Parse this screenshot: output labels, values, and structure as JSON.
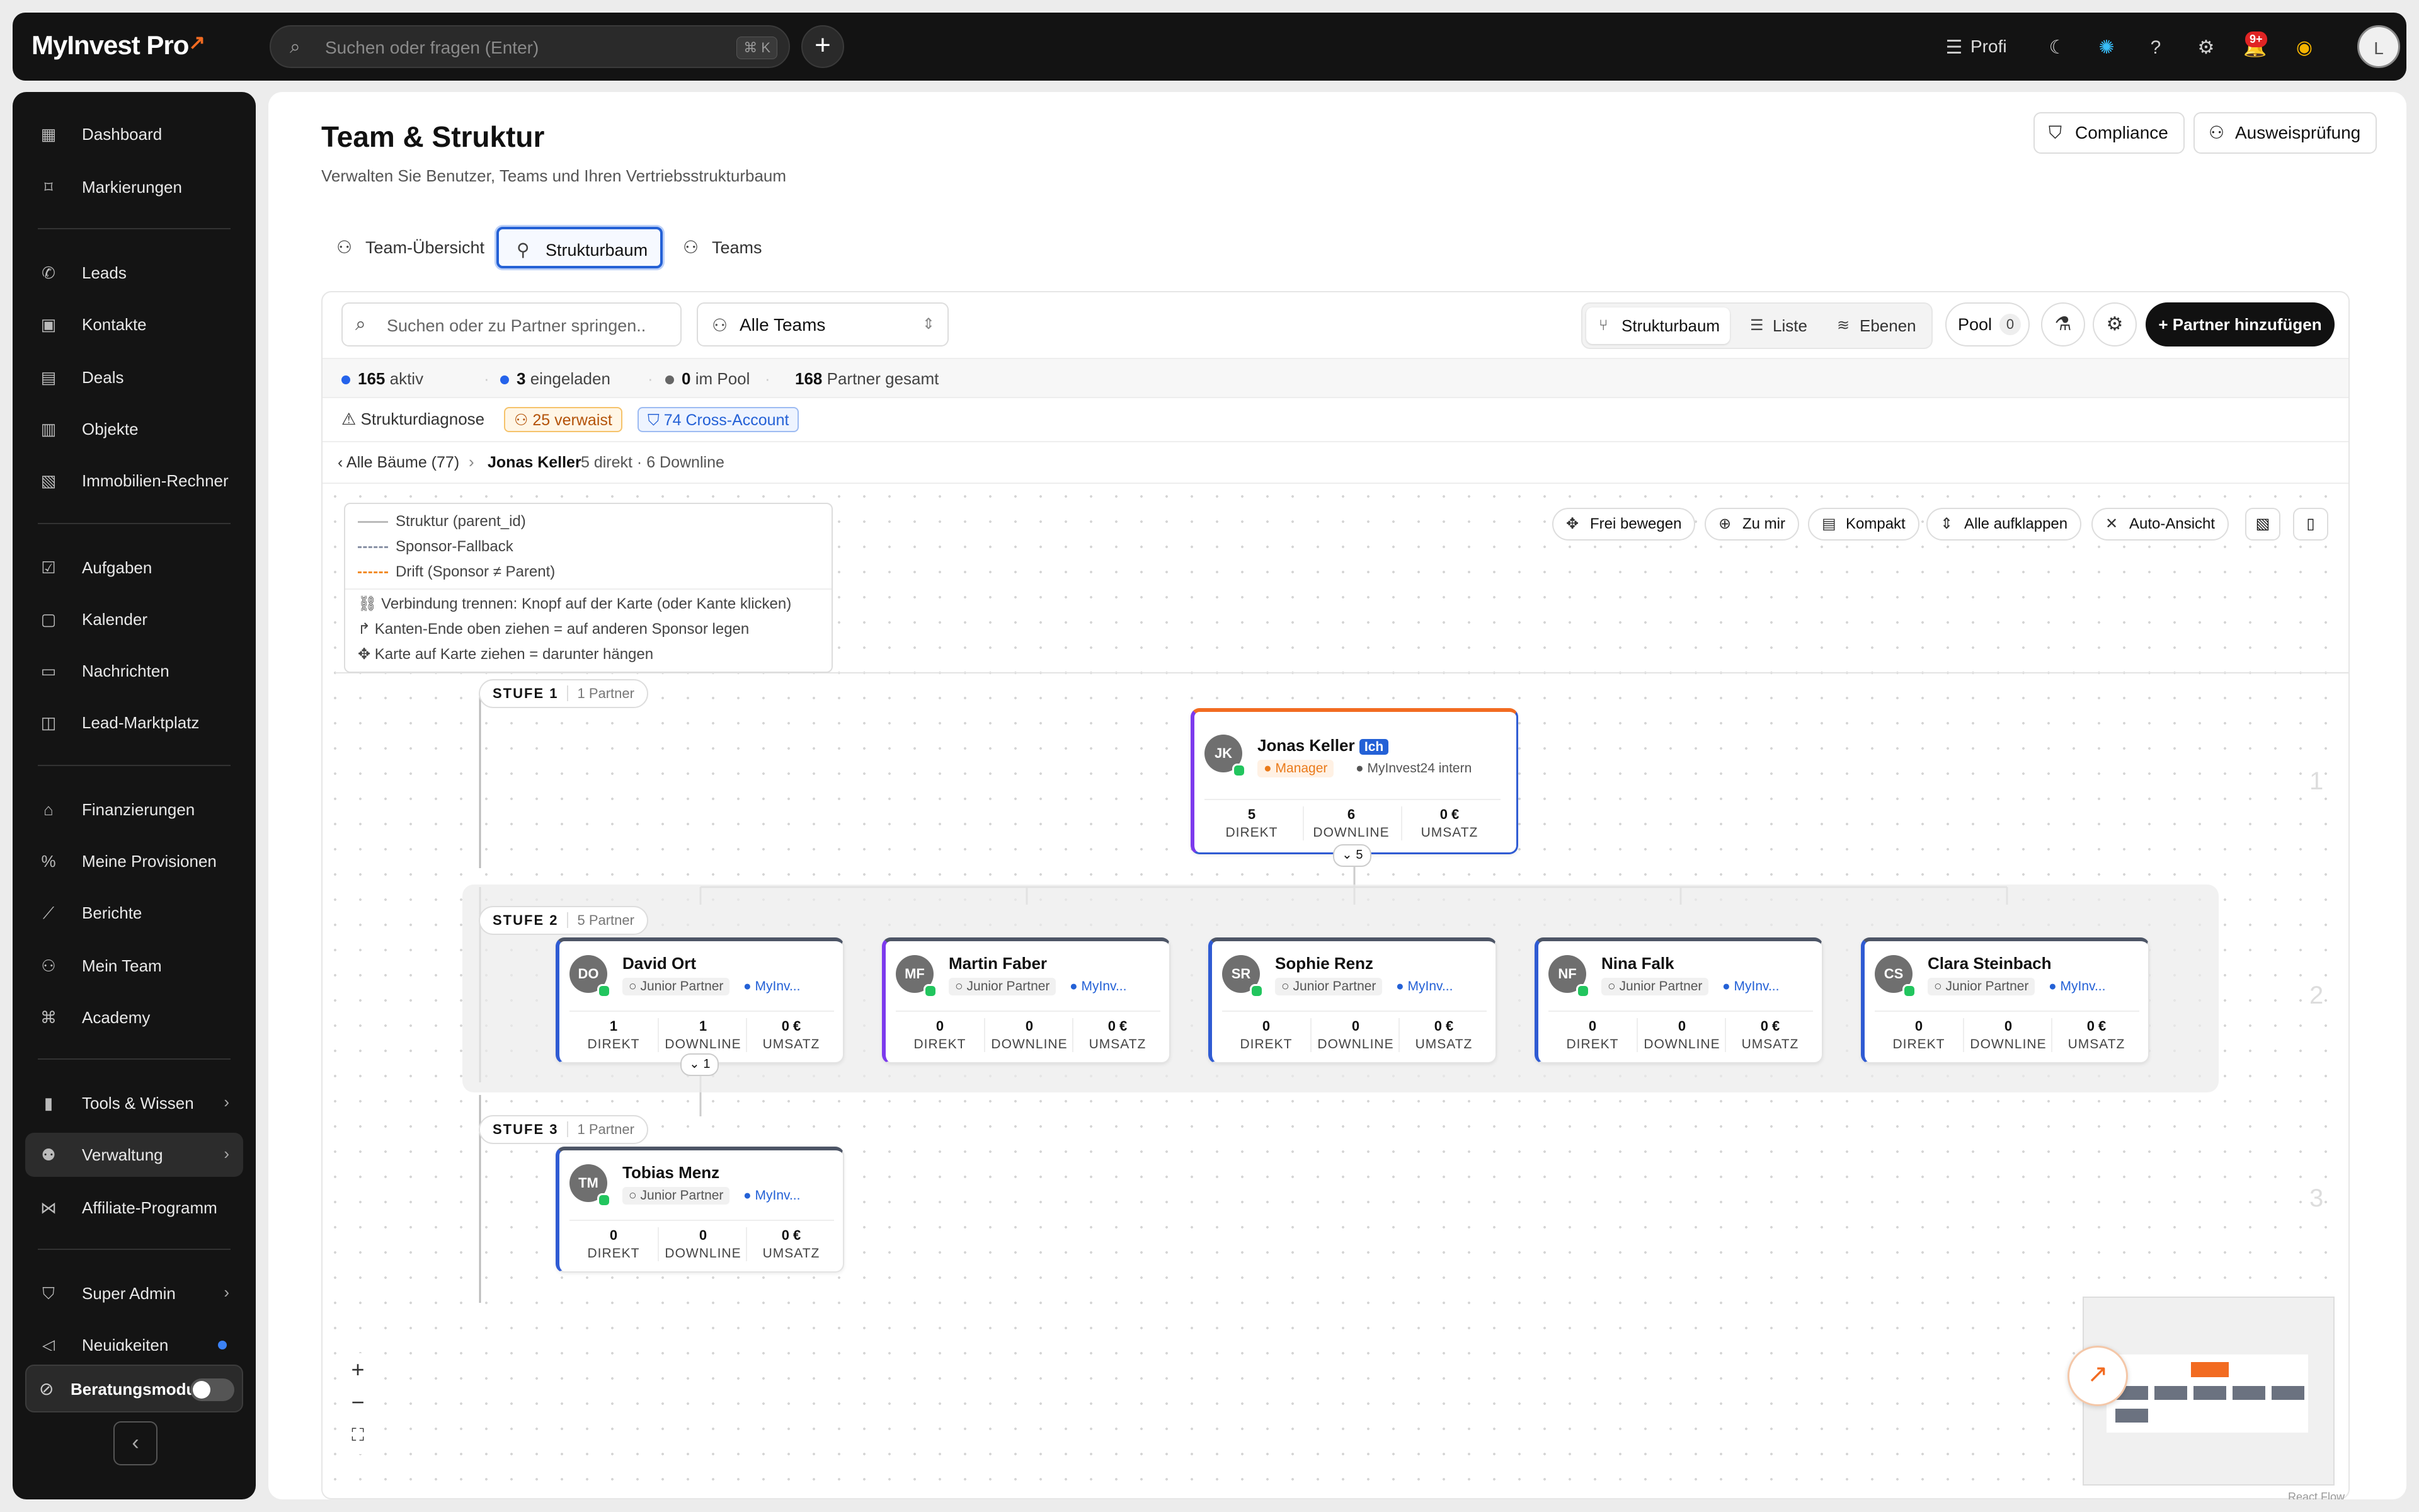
{
  "app": {
    "logo": "MyInvest Pro",
    "logo_mark": "↗"
  },
  "topbar": {
    "search_placeholder": "Suchen oder fragen (Enter)",
    "search_shortcut": "⌘ K",
    "profi_label": "Profi",
    "notif_badge": "9+",
    "avatar_initial": "L"
  },
  "sidebar": {
    "items": [
      {
        "label": "Dashboard",
        "icon": "grid-icon"
      },
      {
        "label": "Markierungen",
        "icon": "bookmark-icon"
      },
      {
        "label": "Leads",
        "icon": "phone-icon"
      },
      {
        "label": "Kontakte",
        "icon": "contact-icon"
      },
      {
        "label": "Deals",
        "icon": "briefcase-icon"
      },
      {
        "label": "Objekte",
        "icon": "building-icon"
      },
      {
        "label": "Immobilien-Rechner",
        "icon": "calculator-icon"
      },
      {
        "label": "Aufgaben",
        "icon": "checkbox-icon"
      },
      {
        "label": "Kalender",
        "icon": "calendar-icon"
      },
      {
        "label": "Nachrichten",
        "icon": "message-icon"
      },
      {
        "label": "Lead-Marktplatz",
        "icon": "shopping-bag-icon"
      },
      {
        "label": "Finanzierungen",
        "icon": "bank-icon"
      },
      {
        "label": "Meine Provisionen",
        "icon": "percent-icon"
      },
      {
        "label": "Berichte",
        "icon": "chart-icon"
      },
      {
        "label": "Mein Team",
        "icon": "users-icon"
      },
      {
        "label": "Academy",
        "icon": "graduation-icon"
      },
      {
        "label": "Tools & Wissen",
        "icon": "bar-chart-icon"
      },
      {
        "label": "Verwaltung",
        "icon": "user-cog-icon"
      },
      {
        "label": "Affiliate-Programm",
        "icon": "share-icon"
      },
      {
        "label": "Super Admin",
        "icon": "shield-icon"
      },
      {
        "label": "Neuigkeiten",
        "icon": "megaphone-icon"
      }
    ],
    "beratung_label": "Beratungsmodus"
  },
  "page": {
    "title": "Team & Struktur",
    "subtitle": "Verwalten Sie Benutzer, Teams und Ihren Vertriebsstrukturbaum",
    "compliance_label": "Compliance",
    "ausweis_label": "Ausweisprüfung",
    "tabs": [
      "Team-Übersicht",
      "Strukturbaum",
      "Teams"
    ]
  },
  "toolbar": {
    "search_placeholder": "Suchen oder zu Partner springen..",
    "team_select": "Alle Teams",
    "views": [
      "Strukturbaum",
      "Liste",
      "Ebenen"
    ],
    "pool_label": "Pool",
    "pool_count": "0",
    "add_partner": "+ Partner hinzufügen"
  },
  "stats": {
    "aktiv_num": "165",
    "aktiv_label": "aktiv",
    "eingeladen_num": "3",
    "eingeladen_label": "eingeladen",
    "pool_num": "0",
    "pool_label": "im Pool",
    "gesamt_num": "168",
    "gesamt_label": "Partner gesamt",
    "colors": {
      "aktiv": "#2563eb",
      "eingeladen": "#2563eb",
      "pool": "#666666"
    }
  },
  "diagnose": {
    "label": "Strukturdiagnose",
    "verwaist": "25 verwaist",
    "cross": "74 Cross-Account"
  },
  "breadcrumb": {
    "back": "‹ Alle Bäume (77)",
    "sep": "›",
    "current": "Jonas Keller",
    "detail": "5 direkt · 6 Downline"
  },
  "legend": {
    "items": [
      "Struktur (parent_id)",
      "Sponsor-Fallback",
      "Drift (Sponsor ≠ Parent)",
      "Verbindung trennen: Knopf auf der Karte (oder Kante klicken)",
      "Kanten-Ende oben ziehen = auf anderen Sponsor legen",
      "Karte auf Karte ziehen = darunter hängen"
    ]
  },
  "canvas_tools": [
    "Frei bewegen",
    "Zu mir",
    "Kompakt",
    "Alle aufklappen",
    "Auto-Ansicht"
  ],
  "levels": [
    {
      "label": "STUFE 1",
      "count": "1 Partner",
      "num": "1"
    },
    {
      "label": "STUFE 2",
      "count": "5 Partner",
      "num": "2"
    },
    {
      "label": "STUFE 3",
      "count": "1 Partner",
      "num": "3"
    }
  ],
  "metric_keys": {
    "direkt": "DIREKT",
    "downline": "DOWNLINE",
    "umsatz": "UMSATZ"
  },
  "partners": [
    {
      "initials": "JK",
      "name": "Jonas Keller",
      "badge": "Ich",
      "role": "● Manager",
      "org": "● MyInvest24 intern",
      "direkt": "5",
      "downline": "6",
      "umsatz": "0 €",
      "expand": "⌄ 5"
    },
    {
      "initials": "DO",
      "name": "David Ort",
      "role": "○ Junior Partner",
      "org": "● MyInv...",
      "direkt": "1",
      "downline": "1",
      "umsatz": "0 €",
      "expand": "⌄ 1"
    },
    {
      "initials": "MF",
      "name": "Martin Faber",
      "role": "○ Junior Partner",
      "org": "● MyInv...",
      "direkt": "0",
      "downline": "0",
      "umsatz": "0 €"
    },
    {
      "initials": "SR",
      "name": "Sophie Renz",
      "role": "○ Junior Partner",
      "org": "● MyInv...",
      "direkt": "0",
      "downline": "0",
      "umsatz": "0 €"
    },
    {
      "initials": "NF",
      "name": "Nina Falk",
      "role": "○ Junior Partner",
      "org": "● MyInv...",
      "direkt": "0",
      "downline": "0",
      "umsatz": "0 €"
    },
    {
      "initials": "CS",
      "name": "Clara Steinbach",
      "role": "○ Junior Partner",
      "org": "● MyInv...",
      "direkt": "0",
      "downline": "0",
      "umsatz": "0 €"
    },
    {
      "initials": "TM",
      "name": "Tobias Menz",
      "role": "○ Junior Partner",
      "org": "● MyInv...",
      "direkt": "0",
      "downline": "0",
      "umsatz": "0 €"
    }
  ],
  "reactflow_label": "React Flow",
  "colors": {
    "accent": "#2461d6",
    "brand_orange": "#f26b21",
    "manager_orange": "#ea7a1a"
  }
}
